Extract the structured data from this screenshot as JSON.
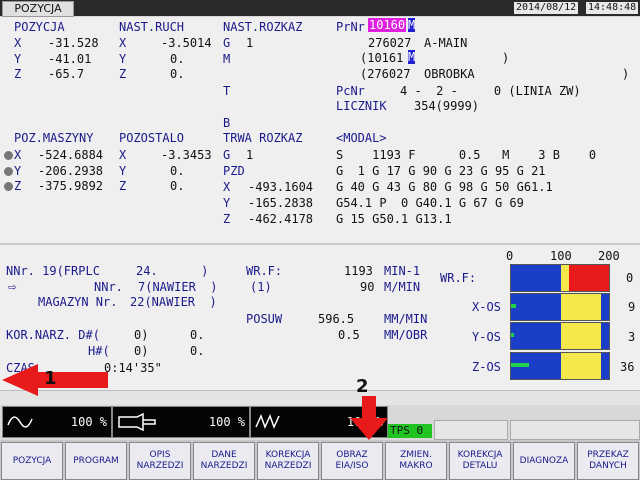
{
  "header": {
    "tab": "POZYCJA",
    "date": "2014/08/12",
    "time": "14:48:48"
  },
  "position": {
    "title": "POZYCJA",
    "x_label": "X",
    "x": "-31.528",
    "y_label": "Y",
    "y": "-41.01",
    "z_label": "Z",
    "z": "-65.7"
  },
  "nast_ruch": {
    "title": "NAST.RUCH",
    "x_label": "X",
    "x": "-3.5014",
    "y_label": "Y",
    "y": "0.",
    "z_label": "Z",
    "z": "0."
  },
  "nast_rozkaz": {
    "title": "NAST.ROZKAZ",
    "g_label": "G",
    "g": "1",
    "m_label": "M",
    "t_label": "T",
    "b_label": "B"
  },
  "program": {
    "prnr_label": "PrNr",
    "prnr_value": "10160",
    "prnr_cursor": "M",
    "line1_num": "276027",
    "line1_name": "A-MAIN",
    "line2_num": "(10161",
    "line2_cursor": "M",
    "line2_close": ")",
    "line3_open": "(276027",
    "line3_name": "OBROBKA",
    "line3_close": ")",
    "pcnr_label": "PcNr",
    "pcnr_values": "4 -  2 -     0 (LINIA ZW)",
    "licznik_label": "LICZNIK",
    "licznik_value": "354(9999)"
  },
  "machine_pos": {
    "title": "POZ.MASZYNY",
    "x_label": "X",
    "x": "-524.6884",
    "y_label": "Y",
    "y": "-206.2938",
    "z_label": "Z",
    "z": "-375.9892"
  },
  "remaining": {
    "title": "POZOSTALO",
    "x_label": "X",
    "x": "-3.3453",
    "y_label": "Y",
    "y": "0.",
    "z_label": "Z",
    "z": "0."
  },
  "current_cmd": {
    "title": "TRWA ROZKAZ",
    "g_label": "G",
    "g": "1",
    "pzd": "PZD",
    "x_label": "X",
    "x": "-493.1604",
    "y_label": "Y",
    "y": "-165.2838",
    "z_label": "Z",
    "z": "-462.4178"
  },
  "modal": {
    "title": "<MODAL>",
    "row1": "S    1193 F      0.5   M    3 B    0",
    "row2": "G  1 G 17 G 90 G 23 G 95 G 21",
    "row3": "G 40 G 43 G 80 G 98 G 50 G61.1",
    "row4": "G54.1 P  0 G40.1 G 67 G 69",
    "row5": "G 15 G50.1 G13.1"
  },
  "tool": {
    "nnr_line": "NNr. 19(FRPLC     24.      )",
    "nnr2_label": "NNr.",
    "nnr2_value": "7(NAWIER  )",
    "magazyn_label": "MAGAZYN Nr.",
    "magazyn_value": "22(NAWIER  )",
    "kor_label": "KOR.NARZ. D#(",
    "kor_d": "0)",
    "kor_d_val": "0.",
    "h_label": "H#(",
    "kor_h": "0)",
    "kor_h_val": "0.",
    "czas_label": "CZAS",
    "czas_value": "0:14'35\""
  },
  "feed": {
    "wrf_label": "WR.F:",
    "wrf_value": "1193",
    "wrf_unit": "MIN-1",
    "f1_label": "(1)",
    "f1_value": "90",
    "f1_unit": "M/MIN",
    "posuw_label": "POSUW",
    "posuw_value": "596.5",
    "posuw_unit": "MM/MIN",
    "obr_value": "0.5",
    "obr_unit": "MM/OBR"
  },
  "load": {
    "scale": [
      "0",
      "100",
      "200"
    ],
    "rows": [
      {
        "label": "WR.F:",
        "value": "0"
      },
      {
        "label": "X-OS",
        "value": "9"
      },
      {
        "label": "Y-OS",
        "value": "3"
      },
      {
        "label": "Z-OS",
        "value": "36"
      }
    ]
  },
  "meters": {
    "m1_pct": "100 %",
    "m2_pct": "100 %",
    "m3_pct": "100 %"
  },
  "tps": "TPS 0",
  "annotations": {
    "a1": "1",
    "a2": "2"
  },
  "softkeys": [
    [
      "POZYCJA",
      ""
    ],
    [
      "PROGRAM",
      ""
    ],
    [
      "OPIS",
      "NARZEDZI"
    ],
    [
      "DANE",
      "NARZEDZI"
    ],
    [
      "KOREKCJA",
      "NARZEDZI"
    ],
    [
      "OBRAZ",
      "EIA/ISO"
    ],
    [
      "ZMIEN.",
      "MAKRO"
    ],
    [
      "KOREKCJA",
      "DETALU"
    ],
    [
      "DIAGNOZA",
      ""
    ],
    [
      "PRZEKAZ",
      "DANYCH"
    ]
  ],
  "colors": {
    "highlight": "#e020e0",
    "cursor": "#2020d0",
    "bar_blue": "#1a3ec8",
    "bar_yellow": "#f5e84b",
    "bar_red": "#e81a1a",
    "bar_green": "#1fd24a",
    "arrow": "#e81a1a"
  }
}
